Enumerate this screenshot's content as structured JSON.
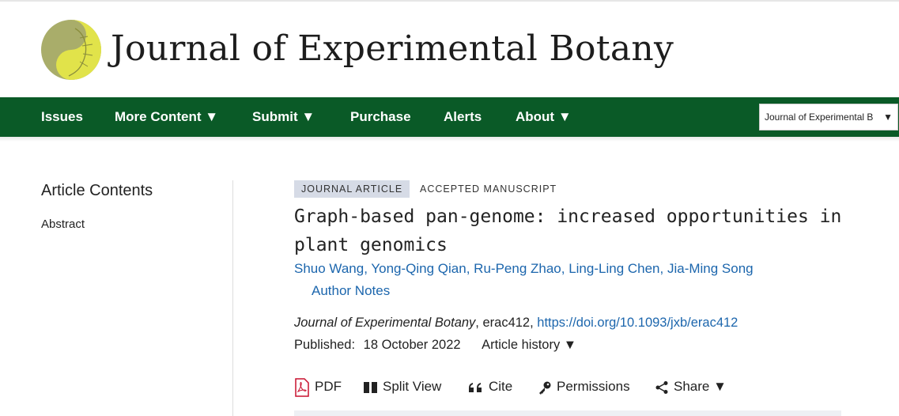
{
  "header": {
    "journal_name": "Journal of Experimental Botany"
  },
  "nav": {
    "items": [
      "Issues",
      "More Content ▼",
      "Submit ▼",
      "Purchase",
      "Alerts",
      "About ▼"
    ],
    "journal_select": "Journal of Experimental B",
    "journal_select_arrow": "▼"
  },
  "sidebar": {
    "title": "Article Contents",
    "links": [
      "Abstract"
    ]
  },
  "article": {
    "type_badge": "JOURNAL ARTICLE",
    "status_badge": "ACCEPTED MANUSCRIPT",
    "title": "Graph-based pan-genome: increased opportunities in plant genomics",
    "authors": [
      "Shuo Wang",
      "Yong-Qing Qian",
      "Ru-Peng Zhao",
      "Ling-Ling Chen",
      "Jia-Ming Song"
    ],
    "author_notes": "Author Notes",
    "journal": "Journal of Experimental Botany",
    "article_id": ", erac412, ",
    "doi": "https://doi.org/10.1093/jxb/erac412",
    "published_label": "Published:",
    "published_date": "18 October 2022",
    "history": "Article history ▼"
  },
  "tools": {
    "pdf": "PDF",
    "split_view": "Split View",
    "cite": "Cite",
    "permissions": "Permissions",
    "share": "Share ▼"
  },
  "colors": {
    "nav_green": "#0a5a27",
    "link_blue": "#1c66ad",
    "badge_bg": "#d6dbe6",
    "logo_olive": "#a9ad6a",
    "logo_yellow": "#e1e34a"
  }
}
